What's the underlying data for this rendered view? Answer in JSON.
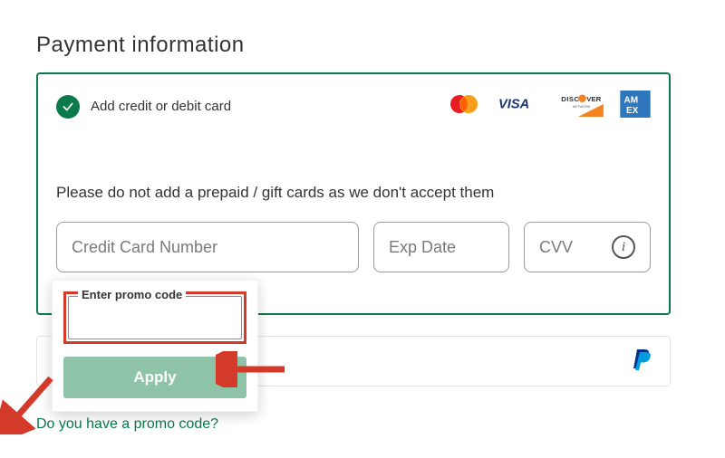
{
  "title": "Payment information",
  "card_panel": {
    "radio_label": "Add credit or debit card",
    "warning": "Please do not add a prepaid / gift cards as we don't accept them",
    "fields": {
      "card_number_placeholder": "Credit Card Number",
      "exp_placeholder": "Exp Date",
      "cvv_placeholder": "CVV"
    }
  },
  "promo": {
    "legend": "Enter promo code",
    "apply_label": "Apply",
    "value": ""
  },
  "promo_link": "Do you have a promo code?"
}
